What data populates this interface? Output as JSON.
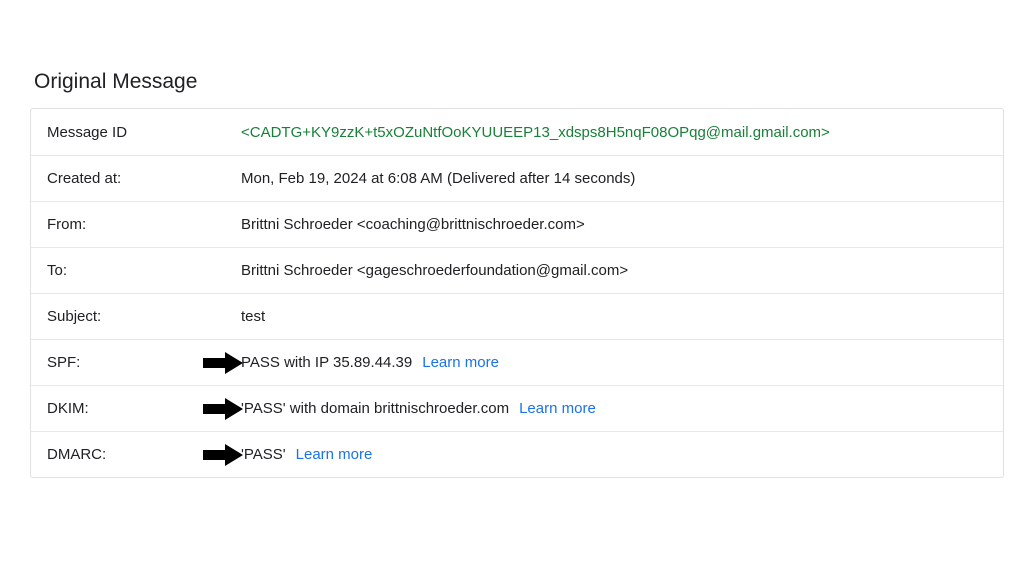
{
  "title": "Original Message",
  "rows": {
    "message_id": {
      "label": "Message ID",
      "value": "<CADTG+KY9zzK+t5xOZuNtfOoKYUUEEP13_xdsps8H5nqF08OPqg@mail.gmail.com>"
    },
    "created_at": {
      "label": "Created at:",
      "value": "Mon, Feb 19, 2024 at 6:08 AM (Delivered after 14 seconds)"
    },
    "from": {
      "label": "From:",
      "value": "Brittni Schroeder <coaching@brittnischroeder.com>"
    },
    "to": {
      "label": "To:",
      "value": "Brittni Schroeder <gageschroederfoundation@gmail.com>"
    },
    "subject": {
      "label": "Subject:",
      "value": "test"
    },
    "spf": {
      "label": "SPF:",
      "value": "PASS with IP 35.89.44.39",
      "learn_more": "Learn more"
    },
    "dkim": {
      "label": "DKIM:",
      "value": "'PASS' with domain brittnischroeder.com",
      "learn_more": "Learn more"
    },
    "dmarc": {
      "label": "DMARC:",
      "value": "'PASS'",
      "learn_more": "Learn more"
    }
  }
}
